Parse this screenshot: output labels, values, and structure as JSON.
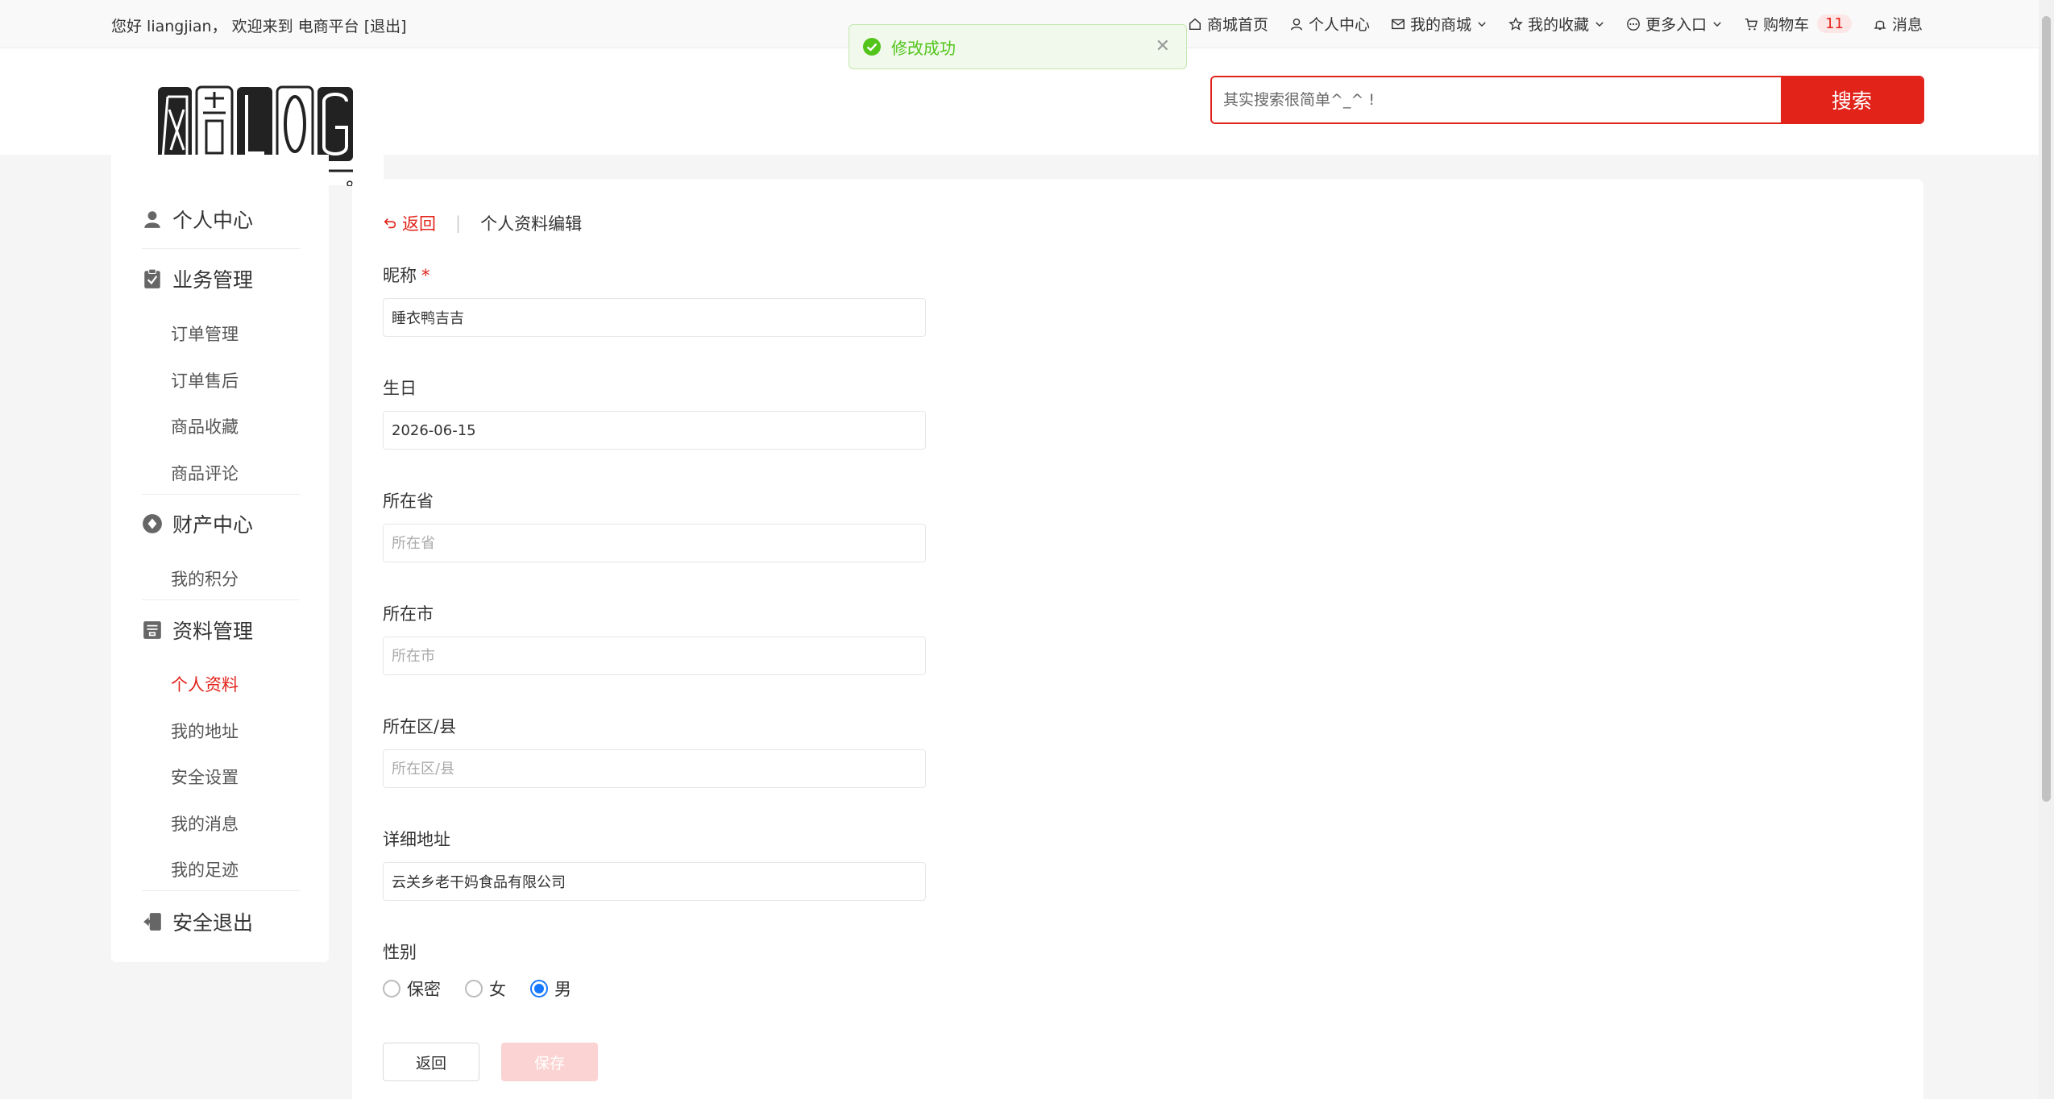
{
  "topbar": {
    "welcome": "您好 liangjian， 欢迎来到 电商平台 [退出]",
    "nav": [
      "商城首页",
      "个人中心",
      "我的商城",
      "我的收藏",
      "更多入口",
      "购物车",
      "消息"
    ],
    "cart_count": "11"
  },
  "toast": {
    "message": "修改成功"
  },
  "search": {
    "placeholder": "其实搜索很简单^_^ !",
    "button": "搜索"
  },
  "sidebar": {
    "personal": "个人中心",
    "business": {
      "title": "业务管理",
      "items": [
        "订单管理",
        "订单售后",
        "商品收藏",
        "商品评论"
      ]
    },
    "finance": {
      "title": "财产中心",
      "items": [
        "我的积分"
      ]
    },
    "profile": {
      "title": "资料管理",
      "items": [
        "个人资料",
        "我的地址",
        "安全设置",
        "我的消息",
        "我的足迹"
      ]
    },
    "logout": "安全退出"
  },
  "main": {
    "back": "返回",
    "breadcrumb": "个人资料编辑",
    "fields": {
      "nickname": {
        "label": "昵称",
        "value": "睡衣鸭吉吉"
      },
      "birthday": {
        "label": "生日",
        "value": "2026-06-15"
      },
      "province": {
        "label": "所在省",
        "placeholder": "所在省"
      },
      "city": {
        "label": "所在市",
        "placeholder": "所在市"
      },
      "district": {
        "label": "所在区/县",
        "placeholder": "所在区/县"
      },
      "address": {
        "label": "详细地址",
        "value": "云关乡老干妈食品有限公司"
      }
    },
    "gender": {
      "label": "性别",
      "options": [
        "保密",
        "女",
        "男"
      ],
      "selected": "男"
    },
    "btn_back": "返回",
    "btn_save": "保存"
  },
  "colors": {
    "accent": "#e2231a",
    "success": "#52c41a",
    "radio": "#1677ff"
  }
}
